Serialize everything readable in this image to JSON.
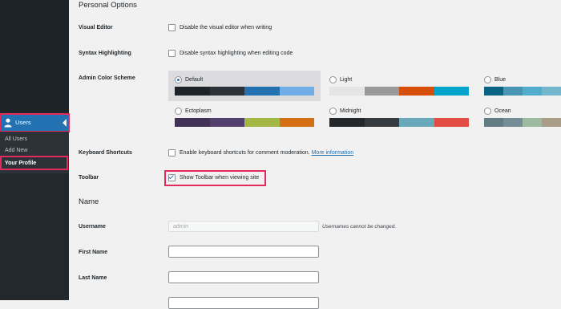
{
  "sidebar": {
    "menu_users_label": "Users",
    "submenu": [
      "All Users",
      "Add New",
      "Your Profile"
    ]
  },
  "sections": {
    "personal_options": "Personal Options",
    "name": "Name"
  },
  "visual_editor": {
    "label": "Visual Editor",
    "option": "Disable the visual editor when writing",
    "checked": false
  },
  "syntax_highlighting": {
    "label": "Syntax Highlighting",
    "option": "Disable syntax highlighting when editing code",
    "checked": false
  },
  "admin_color_scheme": {
    "label": "Admin Color Scheme",
    "schemes": [
      {
        "name": "Default",
        "selected": true,
        "colors": [
          "#1d2327",
          "#2c3338",
          "#2271b1",
          "#72aee6"
        ]
      },
      {
        "name": "Light",
        "selected": false,
        "colors": [
          "#e5e5e5",
          "#999999",
          "#d64e07",
          "#04a4cc"
        ]
      },
      {
        "name": "Blue",
        "selected": false,
        "colors": [
          "#096484",
          "#4796b3",
          "#52accc",
          "#74b6ce"
        ]
      },
      {
        "name": "Ectoplasm",
        "selected": false,
        "colors": [
          "#413256",
          "#523f6d",
          "#a3b745",
          "#d46f15"
        ]
      },
      {
        "name": "Midnight",
        "selected": false,
        "colors": [
          "#25282b",
          "#363b3f",
          "#69a8bb",
          "#e14d43"
        ]
      },
      {
        "name": "Ocean",
        "selected": false,
        "colors": [
          "#627c83",
          "#738e96",
          "#9ebaa0",
          "#aa9d88"
        ]
      }
    ]
  },
  "keyboard_shortcuts": {
    "label": "Keyboard Shortcuts",
    "option": "Enable keyboard shortcuts for comment moderation.",
    "link": "More information",
    "checked": false
  },
  "toolbar": {
    "label": "Toolbar",
    "option": "Show Toolbar when viewing site",
    "checked": true
  },
  "username": {
    "label": "Username",
    "value": "admin",
    "note": "Usernames cannot be changed."
  },
  "first_name": {
    "label": "First Name",
    "value": ""
  },
  "last_name": {
    "label": "Last Name",
    "value": ""
  },
  "colors": {
    "accent": "#2271b1",
    "highlight": "#e22a5d"
  }
}
